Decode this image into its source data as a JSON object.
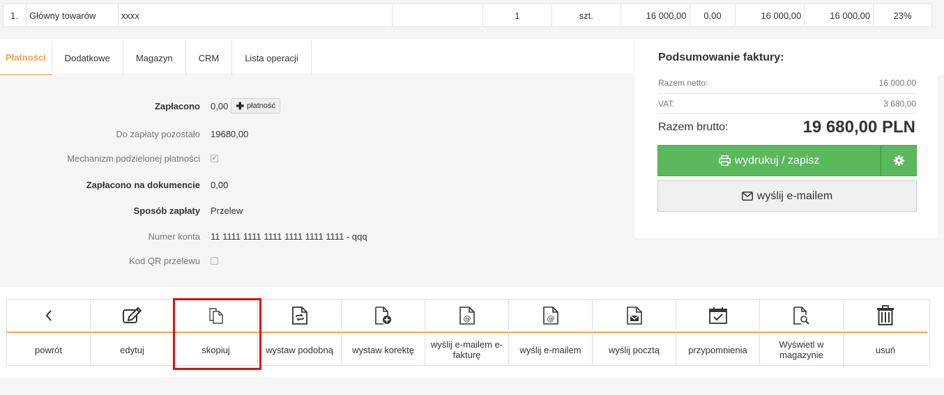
{
  "item_row": {
    "lp": "1.",
    "name": "Główny towarów",
    "desc": "xxxx",
    "qty": "1",
    "unit": "szt.",
    "price": "16 000,00",
    "discount": "0,00",
    "net": "16 000,00",
    "gross": "16 000,00",
    "vat": "23%"
  },
  "tabs": [
    {
      "label": "Płatności",
      "active": true
    },
    {
      "label": "Dodatkowe"
    },
    {
      "label": "Magazyn"
    },
    {
      "label": "CRM"
    },
    {
      "label": "Lista operacji"
    }
  ],
  "payment": {
    "paid_label": "Zapłacono",
    "paid_value": "0,00",
    "add_payment_label": "płatność",
    "remaining_label": "Do zapłaty pozostało",
    "remaining_value": "19680,00",
    "split_label": "Mechanizm podzielonej płatności",
    "split_checked": true,
    "paid_on_doc_label": "Zapłacono na dokumencie",
    "paid_on_doc_value": "0,00",
    "method_label": "Sposób zapłaty",
    "method_value": "Przelew",
    "account_label": "Numer konta",
    "account_value": "11 1111 1111 1111 1111 1111 1111 - qqq",
    "qr_label": "Kod QR przelewu",
    "qr_checked": false
  },
  "summary": {
    "title": "Podsumowanie faktury:",
    "net_label": "Razem netto:",
    "net_value": "16 000,00",
    "vat_label": "VAT:",
    "vat_value": "3 680,00",
    "gross_label": "Razem brutto:",
    "gross_value": "19 680,00 PLN",
    "print_label": "wydrukuj / zapisz",
    "email_label": "wyślij e-mailem"
  },
  "toolbar": [
    {
      "label": "powrót",
      "icon": "chevron-left-icon"
    },
    {
      "label": "edytuj",
      "icon": "edit-icon"
    },
    {
      "label": "skopiuj",
      "icon": "copy-icon",
      "highlighted": true
    },
    {
      "label": "wystaw podobną",
      "icon": "document-refresh-icon"
    },
    {
      "label": "wystaw korektę",
      "icon": "document-add-icon"
    },
    {
      "label": "wyślij e-mailem e-fakturę",
      "icon": "document-at-icon"
    },
    {
      "label": "wyślij e-mailem",
      "icon": "document-at-icon"
    },
    {
      "label": "wyślij pocztą",
      "icon": "document-envelope-icon"
    },
    {
      "label": "przypomnienia",
      "icon": "calendar-check-icon"
    },
    {
      "label": "Wyświetl w magazynie",
      "icon": "document-search-icon"
    },
    {
      "label": "usuń",
      "icon": "trash-icon"
    }
  ],
  "colors": {
    "accent": "#f0a44a",
    "success": "#5cb85c",
    "highlight": "#e01010"
  }
}
